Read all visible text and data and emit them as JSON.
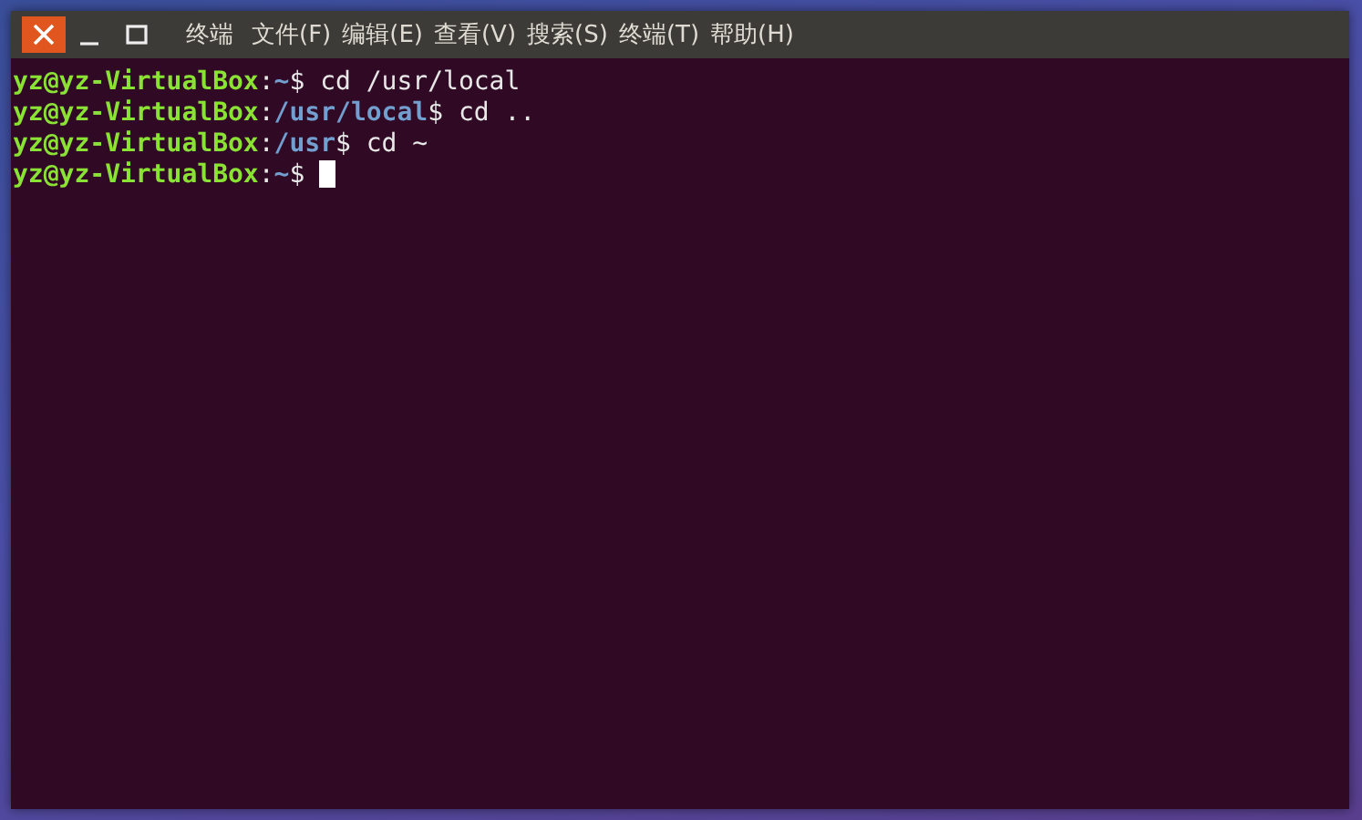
{
  "window": {
    "title": "终端",
    "menu": [
      "文件(F)",
      "编辑(E)",
      "查看(V)",
      "搜索(S)",
      "终端(T)",
      "帮助(H)"
    ]
  },
  "terminal": {
    "lines": [
      {
        "user_host": "yz@yz-VirtualBox",
        "separator": ":",
        "path": "~",
        "sign": "$",
        "command": " cd /usr/local",
        "cursor": false
      },
      {
        "user_host": "yz@yz-VirtualBox",
        "separator": ":",
        "path": "/usr/local",
        "sign": "$",
        "command": " cd ..",
        "cursor": false
      },
      {
        "user_host": "yz@yz-VirtualBox",
        "separator": ":",
        "path": "/usr",
        "sign": "$",
        "command": " cd ~",
        "cursor": false
      },
      {
        "user_host": "yz@yz-VirtualBox",
        "separator": ":",
        "path": "~",
        "sign": "$",
        "cursor": true
      }
    ]
  }
}
